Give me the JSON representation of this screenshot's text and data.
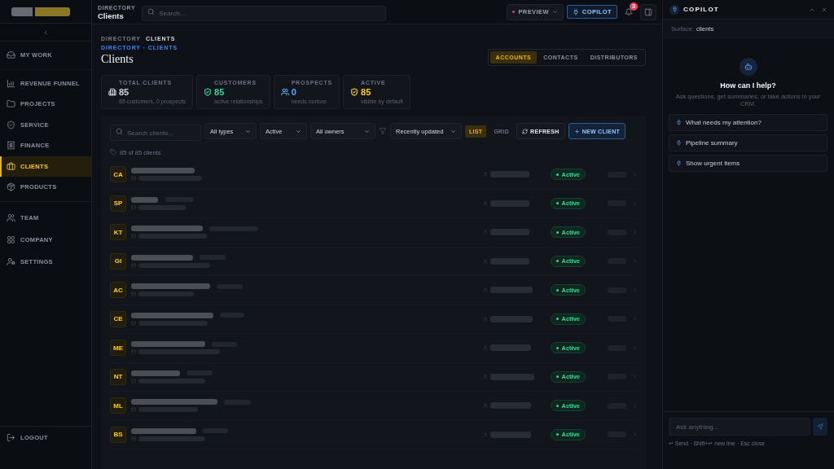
{
  "sidebar": {
    "groups": [
      {
        "items": [
          {
            "label": "MY WORK",
            "selected": false
          }
        ]
      },
      {
        "items": [
          {
            "label": "REVENUE FUNNEL",
            "selected": false
          },
          {
            "label": "PROJECTS",
            "selected": false
          },
          {
            "label": "SERVICE",
            "selected": false
          },
          {
            "label": "FINANCE",
            "selected": false
          },
          {
            "label": "CLIENTS",
            "selected": true
          },
          {
            "label": "PRODUCTS",
            "selected": false
          }
        ]
      },
      {
        "items": [
          {
            "label": "TEAM",
            "selected": false
          },
          {
            "label": "COMPANY",
            "selected": false
          },
          {
            "label": "SETTINGS",
            "selected": false
          }
        ]
      }
    ],
    "logout": "LOGOUT"
  },
  "header": {
    "section": "DIRECTORY",
    "title": "Clients",
    "search": {
      "placeholder": "Search..."
    },
    "preview": "PREVIEW",
    "copilot": "COPILOT",
    "notifications": "3"
  },
  "breadcrumb": [
    "DIRECTORY",
    "CLIENTS"
  ],
  "breadcrumb_link": "DIRECTORY · CLIENTS",
  "page_title": "Clients",
  "tabs": [
    {
      "label": "ACCOUNTS",
      "selected": true
    },
    {
      "label": "CONTACTS",
      "selected": false
    },
    {
      "label": "DISTRIBUTORS",
      "selected": false
    }
  ],
  "stats": [
    {
      "label": "TOTAL CLIENTS",
      "value": "85",
      "note": "85 customers, 0 prospects",
      "color": "#d1d5db"
    },
    {
      "label": "CUSTOMERS",
      "value": "85",
      "note": "active relationships",
      "color": "#34d399"
    },
    {
      "label": "PROSPECTS",
      "value": "0",
      "note": "needs nurture",
      "color": "#60a5fa"
    },
    {
      "label": "ACTIVE",
      "value": "85",
      "note": "visible by default",
      "color": "#facc15"
    }
  ],
  "filters": {
    "search": {
      "placeholder": "Search clients..."
    },
    "selects": [
      "All types",
      "Active",
      "All owners"
    ],
    "sort": "Recently updated",
    "views": [
      {
        "label": "LIST",
        "selected": true
      },
      {
        "label": "GRID",
        "selected": false
      }
    ],
    "refresh": "REFRESH",
    "new_client": "NEW CLIENT"
  },
  "count": "85 of 85 clients",
  "clients": [
    {
      "initials": "CA",
      "status": "Active"
    },
    {
      "initials": "SP",
      "status": "Active"
    },
    {
      "initials": "KT",
      "status": "Active"
    },
    {
      "initials": "GI",
      "status": "Active"
    },
    {
      "initials": "AC",
      "status": "Active"
    },
    {
      "initials": "CE",
      "status": "Active"
    },
    {
      "initials": "ME",
      "status": "Active"
    },
    {
      "initials": "NT",
      "status": "Active"
    },
    {
      "initials": "ML",
      "status": "Active"
    },
    {
      "initials": "BS",
      "status": "Active"
    }
  ],
  "copilot": {
    "title": "COPILOT",
    "surface_label": "Surface:",
    "surface": "clients",
    "heading": "How can I help?",
    "hint": "Ask questions, get summaries, or take actions in your CRM.",
    "suggestions": [
      "What needs my attention?",
      "Pipeline summary",
      "Show urgent items"
    ],
    "input": {
      "placeholder": "Ask anything..."
    },
    "footer": "↵ Send · Shift+↵ new line · Esc close"
  }
}
